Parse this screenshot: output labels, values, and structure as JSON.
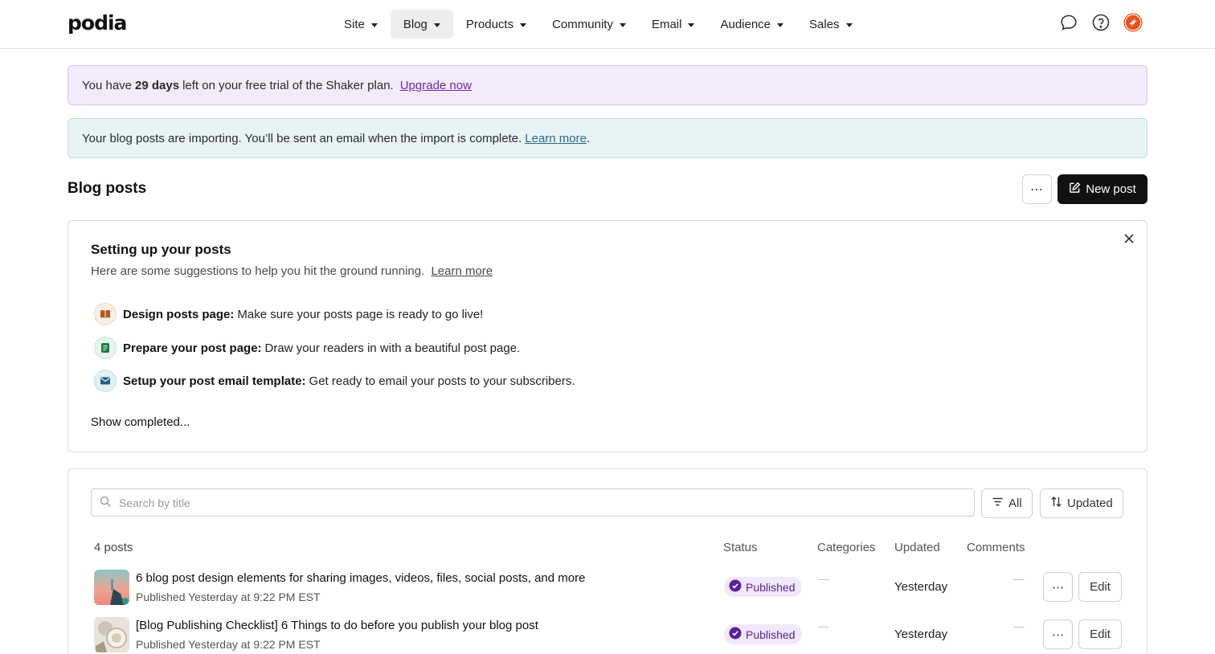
{
  "brand": {
    "logo": "podia"
  },
  "nav": {
    "items": [
      {
        "label": "Site"
      },
      {
        "label": "Blog"
      },
      {
        "label": "Products"
      },
      {
        "label": "Community"
      },
      {
        "label": "Email"
      },
      {
        "label": "Audience"
      },
      {
        "label": "Sales"
      }
    ],
    "active": "Blog",
    "icons": [
      "chat-icon",
      "help-icon",
      "account-avatar-icon"
    ]
  },
  "trial_banner": {
    "before": "You have",
    "days": "29 days",
    "after": "left on your free trial of the Shaker plan.",
    "link": "Upgrade now"
  },
  "import_banner": {
    "text": "Your blog posts are importing. You’ll be sent an email when the import is complete.",
    "link": "Learn more",
    "end": "."
  },
  "page": {
    "title": "Blog posts",
    "more_label": "⋯",
    "new_post_label": "New post"
  },
  "setup": {
    "title": "Setting up your posts",
    "subtitle": "Here are some suggestions to help you hit the ground running.",
    "subtitle_link": "Learn more",
    "tasks": [
      {
        "icon": "book-icon",
        "bold": "Design posts page:",
        "text": "Make sure your posts page is ready to go live!"
      },
      {
        "icon": "document-icon",
        "bold": "Prepare your post page:",
        "text": "Draw your readers in with a beautiful post page."
      },
      {
        "icon": "envelope-icon",
        "bold": "Setup your post email template:",
        "text": "Get ready to email your posts to your subscribers."
      }
    ],
    "show_completed": "Show completed..."
  },
  "posts": {
    "search_placeholder": "Search by title",
    "filter_label": "All",
    "sort_label": "Updated",
    "count_label": "4 posts",
    "columns": {
      "status": "Status",
      "categories": "Categories",
      "updated": "Updated",
      "comments": "Comments"
    },
    "rows": [
      {
        "title": "6 blog post design elements for sharing images, videos, files, social posts, and more",
        "subtitle": "Published Yesterday at 9:22 PM EST",
        "status": "Published",
        "updated": "Yesterday",
        "more_label": "⋯",
        "edit_label": "Edit"
      },
      {
        "title": "[Blog Publishing Checklist] 6 Things to do before you publish your blog post",
        "subtitle": "Published Yesterday at 9:22 PM EST",
        "status": "Published",
        "updated": "Yesterday",
        "more_label": "⋯",
        "edit_label": "Edit"
      }
    ]
  },
  "colors": {
    "accent_purple": "#6a2bb0",
    "badge_bg": "#f1e9fb",
    "trial_bg": "#f3eafb",
    "import_bg": "#e8f3f6",
    "primary_button": "#111111"
  }
}
